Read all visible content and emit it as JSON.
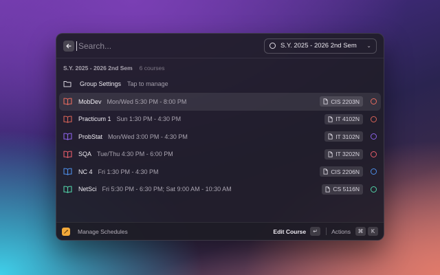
{
  "search": {
    "placeholder": "Search..."
  },
  "semester_dropdown": {
    "selected": "S.Y. 2025 - 2026 2nd Sem"
  },
  "section": {
    "title": "S.Y. 2025 - 2026 2nd Sem",
    "count": "6 courses"
  },
  "group_settings": {
    "title": "Group Settings",
    "subtitle": "Tap to manage"
  },
  "courses": [
    {
      "name": "MobDev",
      "schedule": "Mon/Wed 5:30 PM - 8:00 PM",
      "code": "CIS 2203N",
      "color": "#e76b5f"
    },
    {
      "name": "Practicum 1",
      "schedule": "Sun 1:30 PM - 4:30 PM",
      "code": "IT 4102N",
      "color": "#d96457"
    },
    {
      "name": "ProbStat",
      "schedule": "Mon/Wed 3:00 PM - 4:30 PM",
      "code": "IT 3102N",
      "color": "#8b62e8"
    },
    {
      "name": "SQA",
      "schedule": "Tue/Thu 4:30 PM - 6:00 PM",
      "code": "IT 3202N",
      "color": "#e85d6a"
    },
    {
      "name": "NC 4",
      "schedule": "Fri 1:30 PM - 4:30 PM",
      "code": "CIS 2206N",
      "color": "#4d8ee8"
    },
    {
      "name": "NetSci",
      "schedule": "Fri 5:30 PM - 6:30 PM; Sat 9:00 AM - 10:30 AM",
      "code": "CS 5116N",
      "color": "#52d4a8"
    }
  ],
  "footer": {
    "manage_label": "Manage Schedules",
    "edit_label": "Edit Course",
    "edit_key": "↵",
    "actions_label": "Actions",
    "actions_key1": "⌘",
    "actions_key2": "K"
  }
}
